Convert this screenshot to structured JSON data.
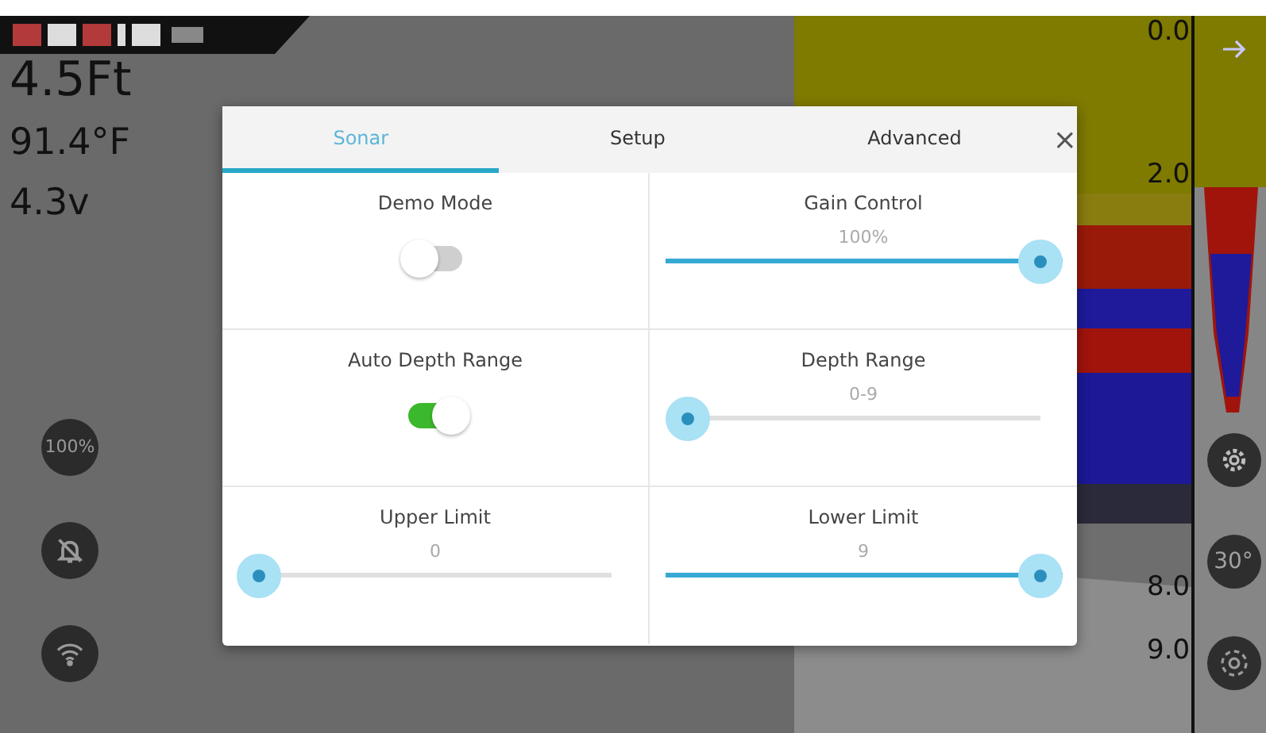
{
  "readouts": [
    "4.5Ft",
    "91.4°F",
    "4.3v"
  ],
  "side_buttons": [
    {
      "kind": "text",
      "label": "100%"
    },
    {
      "kind": "mute"
    },
    {
      "kind": "wifi"
    }
  ],
  "depth_scale": {
    "labels": [
      "0.0",
      "2.0",
      "8.0",
      "9.0"
    ]
  },
  "right_controls": [
    {
      "kind": "arrow"
    },
    {
      "kind": "gear"
    },
    {
      "kind": "text",
      "label": "30°"
    },
    {
      "kind": "ring"
    }
  ],
  "dialog": {
    "tabs": [
      {
        "label": "Sonar",
        "selected": true
      },
      {
        "label": "Setup",
        "selected": false
      },
      {
        "label": "Advanced",
        "selected": false
      }
    ],
    "close": "×",
    "settings": [
      {
        "kind": "toggle",
        "label": "Demo Mode",
        "on": false
      },
      {
        "kind": "slider",
        "label": "Gain Control",
        "reading": "100%",
        "level": 1
      },
      {
        "kind": "toggle",
        "label": "Auto Depth Range",
        "on": true
      },
      {
        "kind": "slider",
        "label": "Depth Range",
        "reading": "0-9",
        "level": 0
      },
      {
        "kind": "slider",
        "label": "Upper Limit",
        "reading": "0",
        "level": 0
      },
      {
        "kind": "slider",
        "label": "Lower Limit",
        "reading": "9",
        "level": 1
      }
    ]
  }
}
